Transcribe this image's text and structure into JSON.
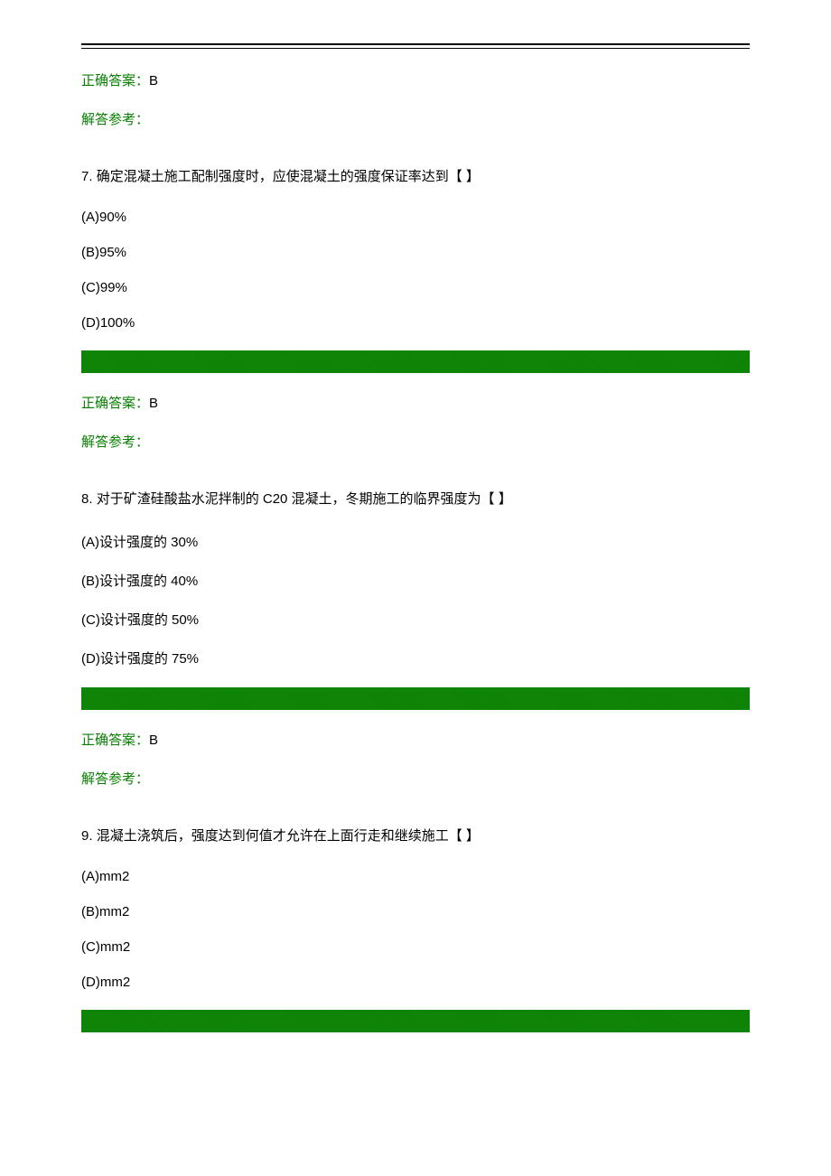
{
  "answer_block_top": {
    "answer_label": "正确答案：",
    "answer_value": "B",
    "explanation_label": "解答参考："
  },
  "questions": [
    {
      "number": "7. ",
      "text": "确定混凝土施工配制强度时，应使混凝土的强度保证率达到【 】",
      "options": [
        "(A)90%",
        "(B)95%",
        "(C)99%",
        "(D)100%"
      ],
      "answer_label": "正确答案：",
      "answer_value": "B",
      "explanation_label": "解答参考："
    },
    {
      "number": "8. ",
      "text": "对于矿渣硅酸盐水泥拌制的 C20 混凝土，冬期施工的临界强度为【 】",
      "options": [
        "(A)设计强度的 30%",
        "(B)设计强度的 40%",
        "(C)设计强度的 50%",
        "(D)设计强度的 75%"
      ],
      "answer_label": "正确答案：",
      "answer_value": "B",
      "explanation_label": "解答参考："
    },
    {
      "number": "9. ",
      "text": "混凝土浇筑后，强度达到何值才允许在上面行走和继续施工【 】",
      "options": [
        "(A)mm2",
        "(B)mm2",
        "(C)mm2",
        "(D)mm2"
      ],
      "answer_label": "",
      "answer_value": "",
      "explanation_label": ""
    }
  ]
}
